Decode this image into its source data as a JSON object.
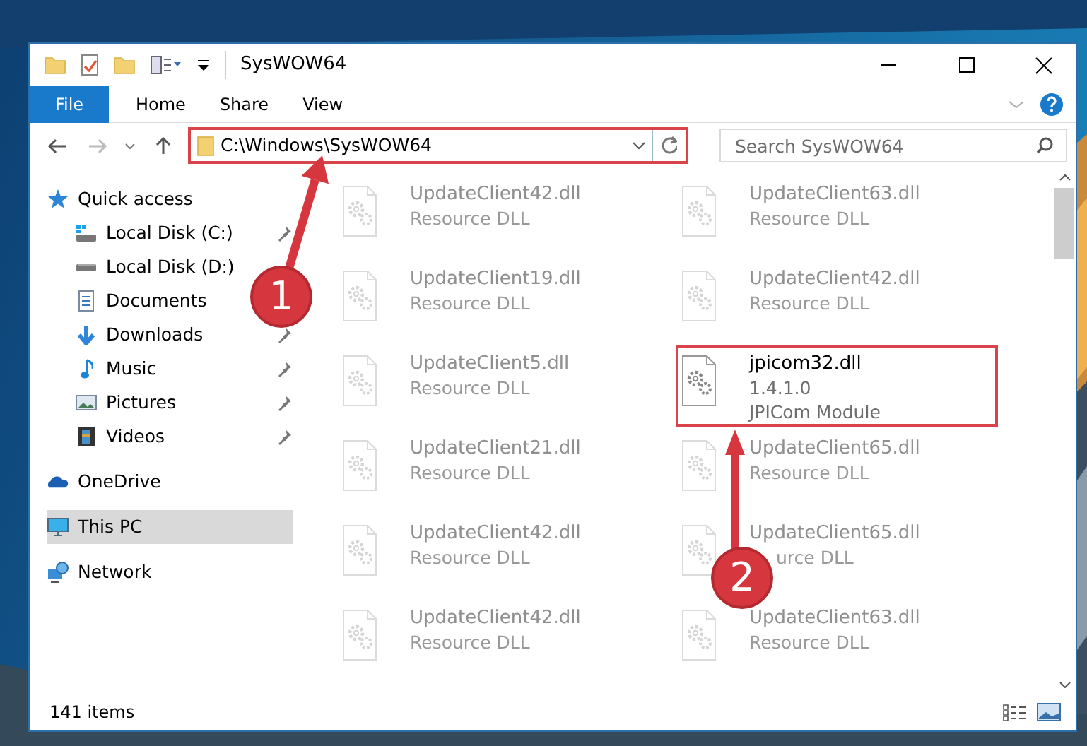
{
  "window": {
    "title": "SysWOW64"
  },
  "file_menu": "File",
  "ribbon_tabs": [
    "Home",
    "Share",
    "View"
  ],
  "address": {
    "path": "C:\\Windows\\SysWOW64",
    "highlighted": true
  },
  "search": {
    "placeholder": "Search SysWOW64"
  },
  "nav": [
    {
      "label": "Quick access",
      "kind": "star",
      "selected": false,
      "children": [
        {
          "label": "Local Disk (C:)",
          "kind": "drive-c",
          "pinned": true
        },
        {
          "label": "Local Disk (D:)",
          "kind": "drive"
        },
        {
          "label": "Documents",
          "kind": "documents"
        },
        {
          "label": "Downloads",
          "kind": "downloads",
          "pinned": true
        },
        {
          "label": "Music",
          "kind": "music",
          "pinned": true
        },
        {
          "label": "Pictures",
          "kind": "pictures",
          "pinned": true
        },
        {
          "label": "Videos",
          "kind": "videos",
          "pinned": true
        }
      ]
    },
    {
      "label": "OneDrive",
      "kind": "cloud",
      "selected": false
    },
    {
      "label": "This PC",
      "kind": "pc",
      "selected": true
    },
    {
      "label": "Network",
      "kind": "network",
      "selected": false
    }
  ],
  "files": [
    {
      "name": "UpdateClient42.dll",
      "description": "Resource DLL",
      "faded": true,
      "highlighted": false
    },
    {
      "name": "UpdateClient63.dll",
      "description": "Resource DLL",
      "faded": true,
      "highlighted": false
    },
    {
      "name": "UpdateClient19.dll",
      "description": "Resource DLL",
      "faded": true,
      "highlighted": false
    },
    {
      "name": "UpdateClient42.dll",
      "description": "Resource DLL",
      "faded": true,
      "highlighted": false
    },
    {
      "name": "UpdateClient5.dll",
      "description": "Resource DLL",
      "faded": true,
      "highlighted": false
    },
    {
      "name": "jpicom32.dll",
      "version": "1.4.1.0",
      "description": "JPICom Module",
      "faded": false,
      "highlighted": true
    },
    {
      "name": "UpdateClient21.dll",
      "description": "Resource DLL",
      "faded": true,
      "highlighted": false
    },
    {
      "name": "UpdateClient65.dll",
      "description": "Resource DLL",
      "faded": true,
      "highlighted": false
    },
    {
      "name": "UpdateClient42.dll",
      "description": "Resource DLL",
      "faded": true,
      "highlighted": false
    },
    {
      "name": "UpdateClient65.dll",
      "description": "urce DLL",
      "faded": true,
      "highlighted": false
    },
    {
      "name": "UpdateClient42.dll",
      "description": "Resource DLL",
      "faded": true,
      "highlighted": false
    },
    {
      "name": "UpdateClient63.dll",
      "description": "Resource DLL",
      "faded": true,
      "highlighted": false
    }
  ],
  "status_bar": {
    "item_count": "141 items"
  },
  "callouts": [
    {
      "number": "1"
    },
    {
      "number": "2"
    }
  ]
}
